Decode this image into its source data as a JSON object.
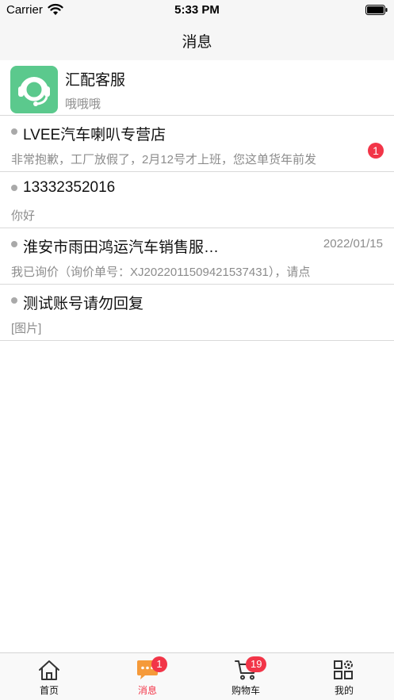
{
  "status_bar": {
    "carrier": "Carrier",
    "time": "5:33 PM"
  },
  "nav": {
    "title": "消息"
  },
  "messages": [
    {
      "name": "汇配客服",
      "preview": "哦哦哦",
      "has_avatar": true,
      "avatar_icon": "headset-icon"
    },
    {
      "name": "LVEE汽车喇叭专营店",
      "preview": "非常抱歉，工厂放假了，2月12号才上班，您这单货年前发",
      "unread": "1"
    },
    {
      "name": "13332352016",
      "preview": "你好"
    },
    {
      "name": "淮安市雨田鸿运汽车销售服…",
      "preview": "我已询价（询价单号：XJ2022011509421537431），请点",
      "date": "2022/01/15"
    },
    {
      "name": "测试账号请勿回复",
      "preview": "[图片]"
    }
  ],
  "tabs": [
    {
      "label": "首页",
      "icon": "home-icon",
      "active": false
    },
    {
      "label": "消息",
      "icon": "message-icon",
      "active": true,
      "badge": "1"
    },
    {
      "label": "购物车",
      "icon": "cart-icon",
      "active": false,
      "badge": "19"
    },
    {
      "label": "我的",
      "icon": "profile-grid-icon",
      "active": false
    }
  ],
  "colors": {
    "accent": "#f23548",
    "avatar_bg": "#5bc98d",
    "bar_bg": "#f6f6f6"
  }
}
